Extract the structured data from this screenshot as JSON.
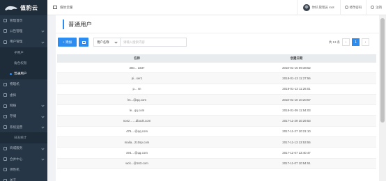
{
  "app": {
    "logo_text": "值豹云"
  },
  "sidebar": {
    "items": [
      {
        "label": "管理首页",
        "icon": "home-icon"
      },
      {
        "label": "公告管理",
        "icon": "bullhorn-icon",
        "caret": true
      },
      {
        "label": "用户管理",
        "icon": "users-icon",
        "caret": true,
        "expanded": true
      },
      {
        "label": "子用户",
        "sub": true
      },
      {
        "label": "角色权限",
        "sub": true
      },
      {
        "label": "普通用户",
        "sub": true,
        "active": true
      },
      {
        "label": "物理机",
        "icon": "server-icon"
      },
      {
        "label": "虚拟",
        "icon": "cloud-icon"
      },
      {
        "label": "网络",
        "icon": "network-icon",
        "caret": true
      },
      {
        "label": "存储",
        "icon": "storage-icon",
        "caret": true
      },
      {
        "label": "系统运营",
        "icon": "settings-icon",
        "caret": true
      },
      {
        "label": "日志统计",
        "sub": true
      },
      {
        "label": "商城服务",
        "icon": "shop-icon",
        "caret": true
      },
      {
        "label": "合并中心",
        "icon": "merge-icon",
        "caret": true
      },
      {
        "label": "弹性机",
        "icon": "elastic-icon"
      },
      {
        "label": "关于",
        "icon": "info-icon"
      }
    ]
  },
  "topbar": {
    "breadcrumb": "值豹云服",
    "user_label": "你好,管理员 root",
    "links": [
      "修改密码",
      "注销"
    ]
  },
  "page": {
    "title": "普通用户"
  },
  "toolbar": {
    "add_label": "+ 添加",
    "select_value": "用户名称",
    "search_placeholder": "请输入搜索内容"
  },
  "pager": {
    "total_label": "共 13 条",
    "prev": "‹",
    "current": "1",
    "next": "›"
  },
  "table": {
    "columns": [
      "名称",
      "创建日期"
    ],
    "rows": [
      [
        "350... 3337",
        "2018-01-15 09:38:52"
      ],
      [
        "pi...ser1",
        "2018-01-13 11:27:56"
      ],
      [
        "p... sn",
        "2018-01-13 11:26:01"
      ],
      [
        "lm...@qq.com",
        "2018-01-10 10:20:57"
      ],
      [
        "le...qq.com",
        "2018-01-09 11:54:03"
      ],
      [
        "nonz... ...dbook.com",
        "2017-11-29 10:29:53"
      ],
      [
        "476... @qq.com",
        "2017-11-27 10:21:10"
      ],
      [
        "malia...210sp.com",
        "2017-11-13 13:53:55"
      ],
      [
        "x94... @qq.com",
        "2017-11-07 13:40:47"
      ],
      [
        "wck...@163.com",
        "2017-11-07 10:54:51"
      ]
    ]
  }
}
